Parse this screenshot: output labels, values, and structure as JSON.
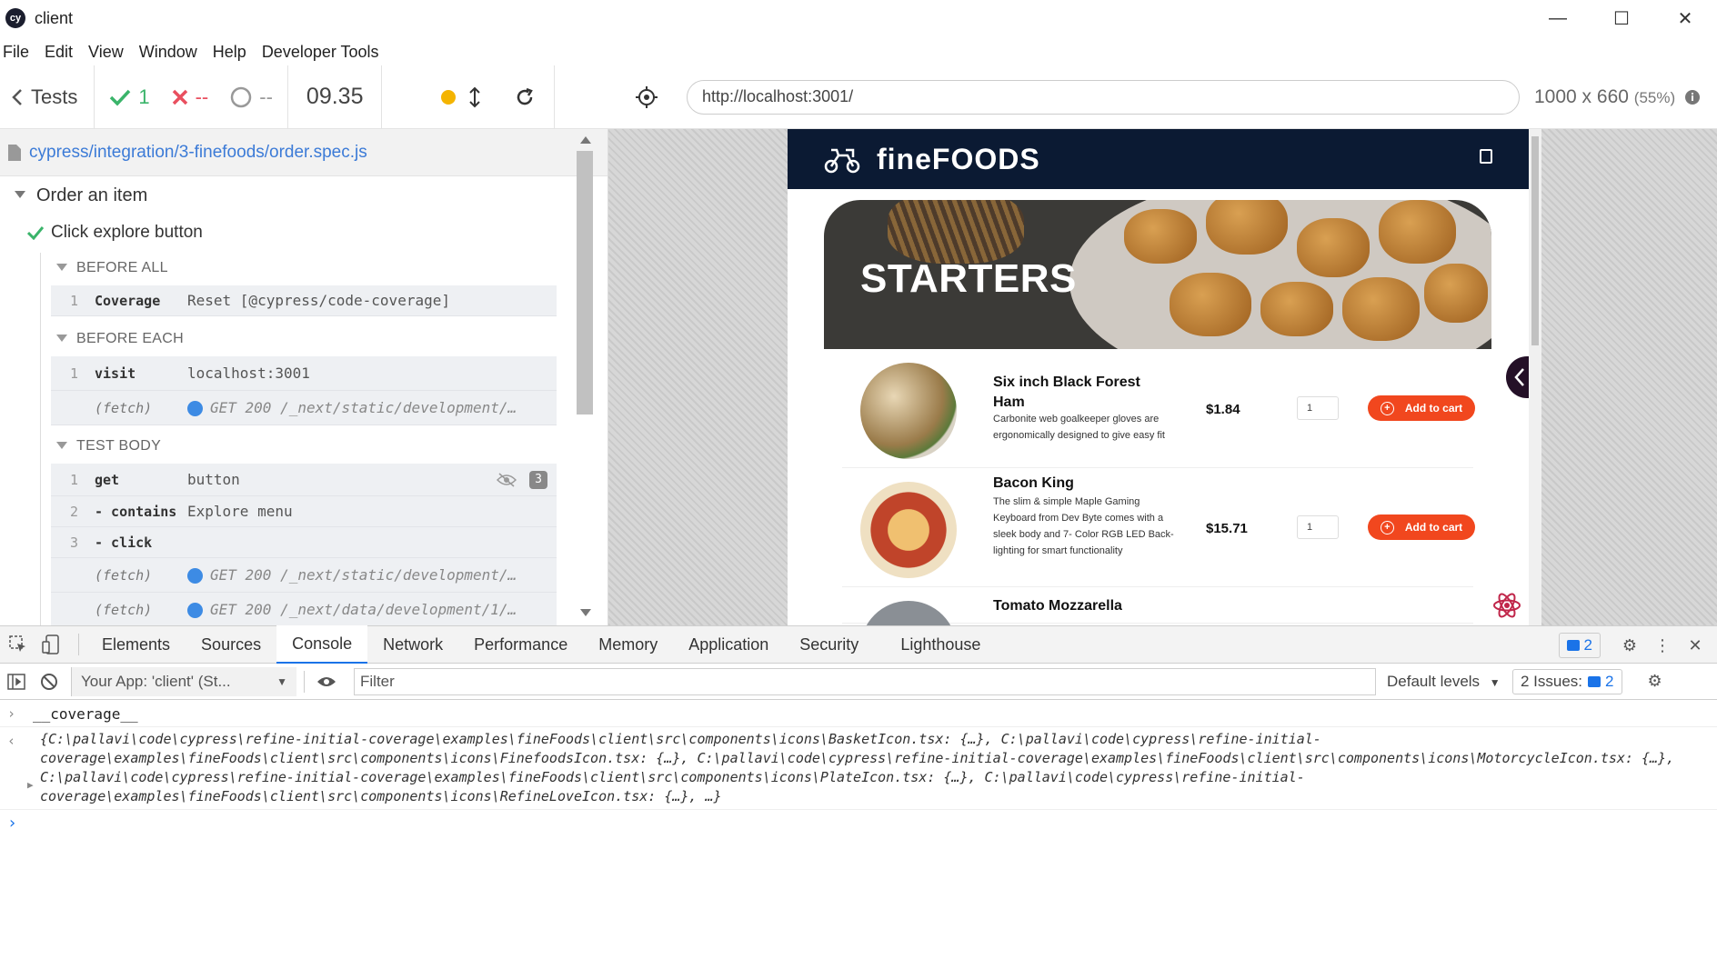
{
  "window": {
    "title": "client",
    "logo_text": "cy",
    "controls": {
      "minimize": "—",
      "maximize": "☐",
      "close": "✕"
    }
  },
  "menu": [
    "File",
    "Edit",
    "Window",
    "Help",
    "Developer Tools"
  ],
  "menu_view": "View",
  "cypress": {
    "tests_label": "Tests",
    "passed": "1",
    "failed": "--",
    "pending": "--",
    "duration": "09.35",
    "url": "http://localhost:3001/",
    "viewport": "1000 x 660",
    "scale": "(55%)"
  },
  "reporter": {
    "spec_path": "cypress/integration/3-finefoods/order.spec.js",
    "suite": "Order an item",
    "test": "Click explore button",
    "hooks": [
      {
        "title": "BEFORE ALL",
        "commands": [
          {
            "num": "1",
            "name": "Coverage",
            "message": "Reset [@cypress/code-coverage]"
          }
        ]
      },
      {
        "title": "BEFORE EACH",
        "commands": [
          {
            "num": "1",
            "name": "visit",
            "message": "localhost:3001"
          },
          {
            "num": "",
            "name": "(fetch)",
            "message": "GET 200 /_next/static/development/…"
          }
        ]
      },
      {
        "title": "TEST BODY",
        "commands": [
          {
            "num": "1",
            "name": "get",
            "message": "button",
            "badge": "3"
          },
          {
            "num": "2",
            "name": "- contains",
            "message": "Explore menu"
          },
          {
            "num": "3",
            "name": "- click",
            "message": ""
          },
          {
            "num": "",
            "name": "(fetch)",
            "message": "GET 200 /_next/static/development/…"
          },
          {
            "num": "",
            "name": "(fetch)",
            "message": "GET 200 /_next/data/development/1/…"
          }
        ]
      }
    ]
  },
  "app": {
    "brand": "fineFOODS",
    "hero_title": "STARTERS",
    "items": [
      {
        "name": "Six inch Black Forest Ham",
        "description": "Carbonite web goalkeeper gloves are ergonomically designed to give easy fit",
        "price": "$1.84",
        "qty": "1",
        "button": "Add to cart"
      },
      {
        "name": "Bacon King",
        "description": "The slim & simple Maple Gaming Keyboard from Dev Byte comes with a sleek body and 7- Color RGB LED Back-lighting for smart functionality",
        "price": "$15.71",
        "qty": "1",
        "button": "Add to cart"
      },
      {
        "name": "Tomato Mozzarella",
        "description": "",
        "price": "",
        "qty": "",
        "button": ""
      }
    ]
  },
  "devtools": {
    "tabs": [
      "Elements",
      "Sources",
      "Console",
      "Network",
      "Performance",
      "Memory",
      "Application",
      "Security",
      "Lighthouse"
    ],
    "active_tab": "Console",
    "message_count": "2",
    "context": "Your App: 'client' (St...",
    "filter_placeholder": "Filter",
    "levels": "Default levels",
    "issues_label": "2 Issues:",
    "issues_count": "2",
    "console": {
      "input": "__coverage__",
      "result": "{C:\\pallavi\\code\\cypress\\refine-initial-coverage\\examples\\fineFoods\\client\\src\\components\\icons\\BasketIcon.tsx: {…}, C:\\pallavi\\code\\cypress\\refine-initial-coverage\\examples\\fineFoods\\client\\src\\components\\icons\\FinefoodsIcon.tsx: {…}, C:\\pallavi\\code\\cypress\\refine-initial-coverage\\examples\\fineFoods\\client\\src\\components\\icons\\MotorcycleIcon.tsx: {…}, C:\\pallavi\\code\\cypress\\refine-initial-coverage\\examples\\fineFoods\\client\\src\\components\\icons\\PlateIcon.tsx: {…}, C:\\pallavi\\code\\cypress\\refine-initial-coverage\\examples\\fineFoods\\client\\src\\components\\icons\\RefineLoveIcon.tsx: {…}, …}"
    }
  }
}
